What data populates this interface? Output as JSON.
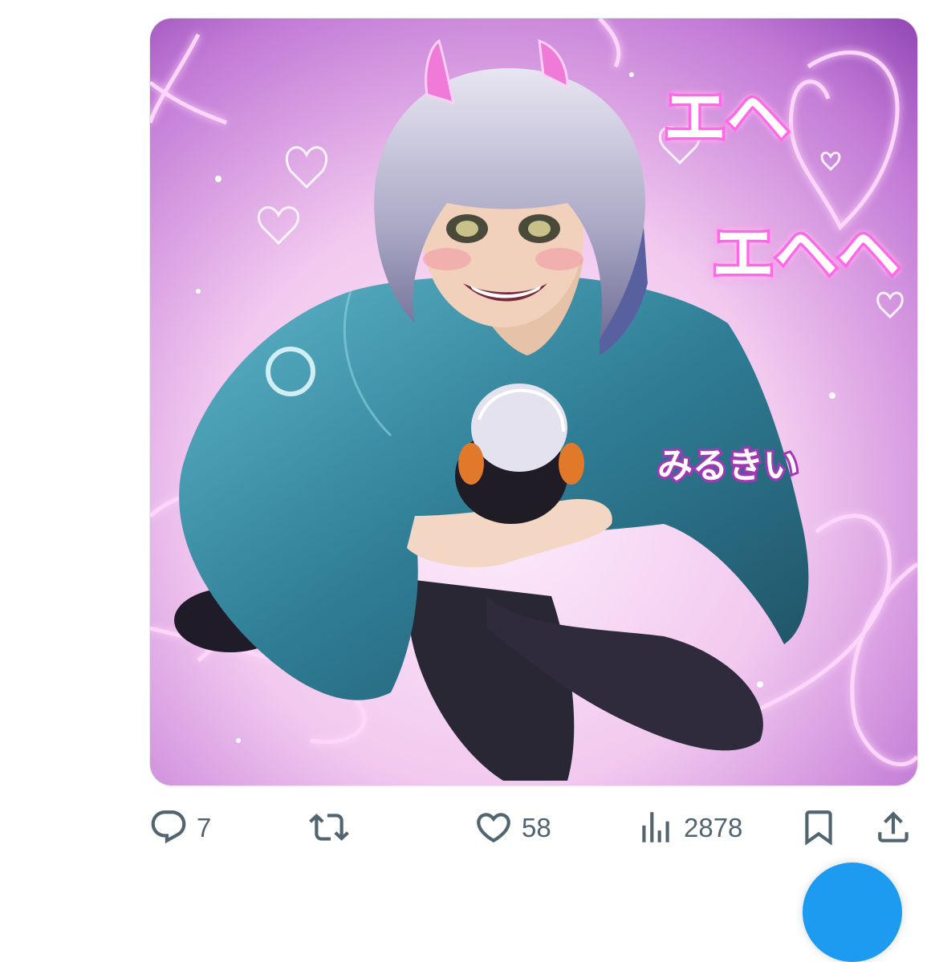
{
  "tweet_media": {
    "alt": "Illustration of a silver-haired oni girl in a teal hooded cape hugging a small plush figure, surrounded by glowing pink hearts",
    "overlay_text_large_1": "エヘ",
    "overlay_text_large_2": "エヘヘ",
    "overlay_text_name": "みるきい",
    "colors": {
      "bg_top": "#8a3fb0",
      "bg_bottom": "#f6dbf3",
      "neon": "#ff7df0",
      "cape": "#3b8fa6",
      "hair": "#c9c7dc"
    }
  },
  "actions": {
    "reply": {
      "icon": "reply-icon",
      "count": "7"
    },
    "repost": {
      "icon": "repost-icon",
      "count": ""
    },
    "like": {
      "icon": "heart-icon",
      "count": "58"
    },
    "views": {
      "icon": "views-icon",
      "count": "2878"
    },
    "bookmark": {
      "icon": "bookmark-icon"
    },
    "share": {
      "icon": "share-icon"
    }
  },
  "accent_color": "#1d9bf0",
  "icon_color": "#536471"
}
